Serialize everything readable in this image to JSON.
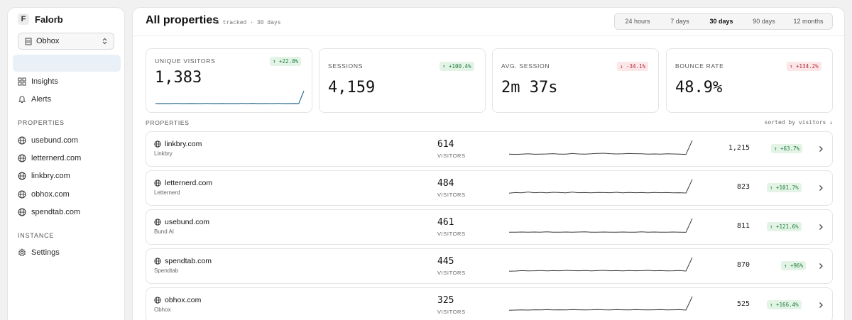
{
  "brand": {
    "logo_letter": "F",
    "name": "Falorb"
  },
  "workspace": {
    "selected": "Obhox"
  },
  "nav": [
    {
      "label": "Insights",
      "icon": "grid-icon"
    },
    {
      "label": "Alerts",
      "icon": "bell-icon"
    }
  ],
  "sections": {
    "properties": "PROPERTIES",
    "instance": "INSTANCE"
  },
  "sidebar_properties": [
    "usebund.com",
    "letternerd.com",
    "linkbry.com",
    "obhox.com",
    "spendtab.com"
  ],
  "instance_nav": [
    {
      "label": "Settings",
      "icon": "gear-icon"
    }
  ],
  "header": {
    "title": "All properties",
    "subtitle": "5 tracked · 30 days"
  },
  "ranges": {
    "options": [
      "24 hours",
      "7 days",
      "30 days",
      "90 days",
      "12 months"
    ],
    "active": "30 days"
  },
  "stats": [
    {
      "label": "UNIQUE VISITORS",
      "value": "1,383",
      "change": "+22.8%",
      "direction": "up",
      "sparkline": [
        2,
        2,
        2,
        2,
        2.2,
        2,
        2,
        2.1,
        2,
        2,
        2.2,
        2,
        2,
        2.1,
        2,
        2,
        2,
        2.2,
        2,
        2.3,
        2,
        2,
        2.1,
        2,
        2.2,
        2,
        2,
        2.1,
        2,
        14
      ]
    },
    {
      "label": "SESSIONS",
      "value": "4,159",
      "change": "+100.4%",
      "direction": "up"
    },
    {
      "label": "AVG. SESSION",
      "value": "2m 37s",
      "change": "-34.1%",
      "direction": "down"
    },
    {
      "label": "BOUNCE RATE",
      "value": "48.9%",
      "change": "+134.2%",
      "direction": "up_bad"
    }
  ],
  "properties_section": {
    "label": "PROPERTIES",
    "sort": "sorted by visitors ↓"
  },
  "properties": [
    {
      "domain": "linkbry.com",
      "name": "Linkbry",
      "visitors": "614",
      "visitors_label": "VISITORS",
      "previous": "1,215",
      "change": "+63.7%",
      "sparkline": [
        2,
        1.8,
        2,
        2.2,
        1.9,
        2,
        2.1,
        2.3,
        2,
        2,
        2.4,
        2.1,
        2,
        2.2,
        2.5,
        2.6,
        2.3,
        2.1,
        2.2,
        2.4,
        2.3,
        2.2,
        2,
        2.1,
        2,
        2.2,
        2.1,
        2,
        1.8,
        12
      ]
    },
    {
      "domain": "letternerd.com",
      "name": "Letternerd",
      "visitors": "484",
      "visitors_label": "VISITORS",
      "previous": "823",
      "change": "+101.7%",
      "sparkline": [
        2,
        2.4,
        2.2,
        2.8,
        2.3,
        2.5,
        2.2,
        2.6,
        2.4,
        2.2,
        2.7,
        2.3,
        2.4,
        2.2,
        2.5,
        2.4,
        2.3,
        2.6,
        2.2,
        2.5,
        2.3,
        2.4,
        2.2,
        2.5,
        2.3,
        2.4,
        2.2,
        2.3,
        2.1,
        12
      ]
    },
    {
      "domain": "usebund.com",
      "name": "Bund AI",
      "visitors": "461",
      "visitors_label": "VISITORS",
      "previous": "811",
      "change": "+121.6%",
      "sparkline": [
        2,
        2,
        2.1,
        2,
        2.1,
        2,
        2.2,
        2,
        2,
        2.1,
        2,
        2.1,
        2.2,
        2,
        2,
        2.1,
        2,
        2,
        2.1,
        2,
        2,
        2.2,
        2,
        2.1,
        2,
        2,
        2.1,
        2,
        1.9,
        12
      ]
    },
    {
      "domain": "spendtab.com",
      "name": "Spendtab",
      "visitors": "445",
      "visitors_label": "VISITORS",
      "previous": "870",
      "change": "+96%",
      "sparkline": [
        2,
        2.1,
        2.4,
        2.2,
        2.3,
        2.5,
        2.2,
        2.4,
        2.3,
        2.6,
        2.4,
        2.3,
        2.5,
        2.2,
        2.4,
        2.6,
        2.3,
        2.4,
        2.2,
        2.5,
        2.3,
        2.4,
        2.6,
        2.3,
        2.4,
        2.2,
        2.3,
        2.5,
        2.1,
        12
      ]
    },
    {
      "domain": "obhox.com",
      "name": "Obhox",
      "visitors": "325",
      "visitors_label": "VISITORS",
      "previous": "525",
      "change": "+166.4%",
      "sparkline": [
        2,
        2.1,
        2.2,
        2.1,
        2.3,
        2.2,
        2.4,
        2.2,
        2.3,
        2.2,
        2.4,
        2.3,
        2.2,
        2.3,
        2.5,
        2.3,
        2.2,
        2.4,
        2.3,
        2.2,
        2.4,
        2.3,
        2.2,
        2.3,
        2.4,
        2.2,
        2.3,
        2.4,
        2.1,
        12
      ]
    }
  ],
  "colors": {
    "accent": "#2f6f95",
    "up_bg": "#e3f4e7",
    "up_fg": "#1f7a3a",
    "down_bg": "#fbe6e8",
    "down_fg": "#b4283a"
  }
}
